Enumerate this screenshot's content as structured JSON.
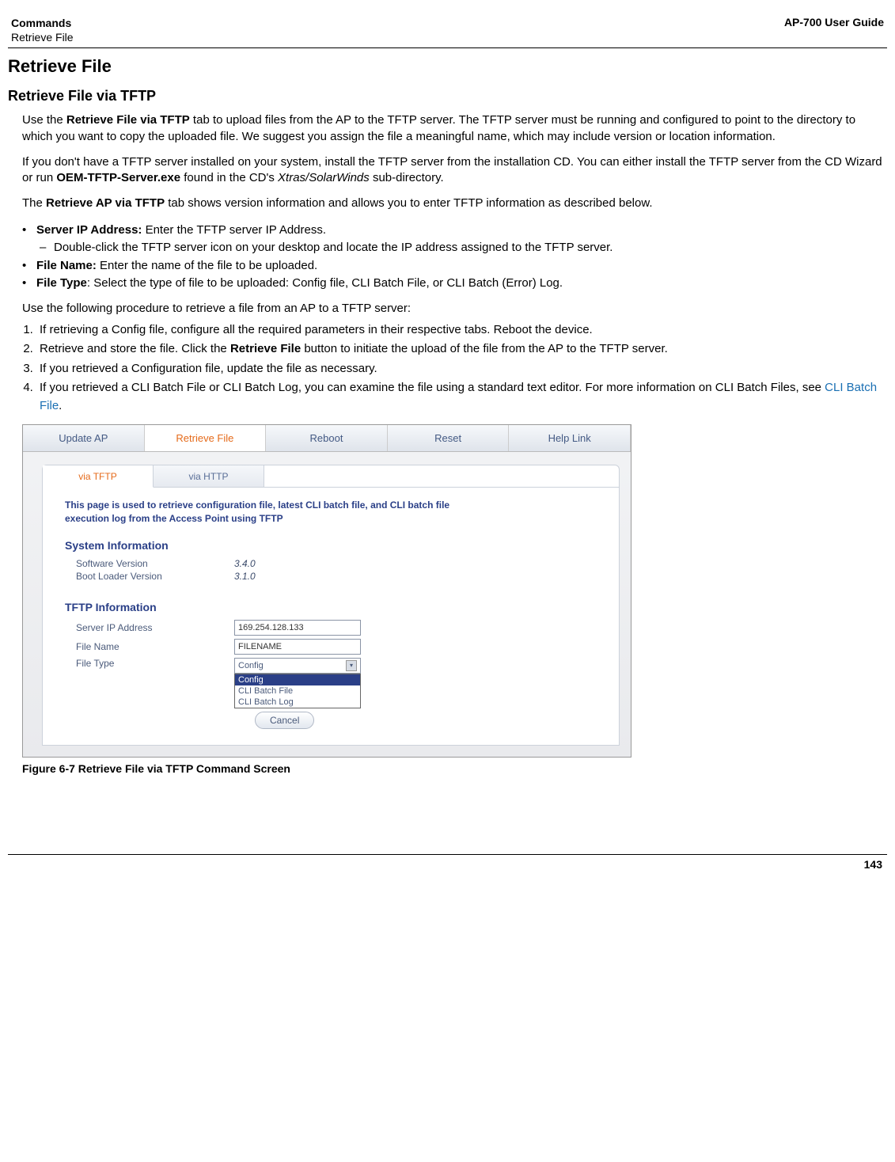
{
  "header": {
    "left_top": "Commands",
    "left_sub": "Retrieve File",
    "right": "AP-700 User Guide"
  },
  "titles": {
    "h1": "Retrieve File",
    "h2": "Retrieve File via TFTP"
  },
  "para1_a": "Use the ",
  "para1_b": "Retrieve File via TFTP",
  "para1_c": " tab to upload files from the AP to the TFTP server. The TFTP server must be running and configured to point to the directory to which you want to copy the uploaded file. We suggest you assign the file a meaningful name, which may include version or location information.",
  "para2_a": "If you don't have a TFTP server installed on your system, install the TFTP server from the installation CD. You can either install the TFTP server from the CD Wizard or run ",
  "para2_b": "OEM-TFTP-Server.exe",
  "para2_c": " found in the CD's ",
  "para2_d": "Xtras/SolarWinds",
  "para2_e": " sub-directory.",
  "para3_a": "The ",
  "para3_b": "Retrieve AP via TFTP",
  "para3_c": " tab shows version information and allows you to enter TFTP information as described below.",
  "bullets": {
    "b1_label": "Server IP Address:",
    "b1_text": " Enter the TFTP server IP Address.",
    "b1_sub": "Double-click the TFTP server icon on your desktop and locate the IP address assigned to the TFTP server.",
    "b2_label": "File Name:",
    "b2_text": " Enter the name of the file to be uploaded.",
    "b3_label": "File Type",
    "b3_text": ": Select the type of file to be uploaded: Config file, CLI Batch File, or CLI Batch (Error) Log."
  },
  "para4": "Use the following procedure to retrieve a file from an AP to a TFTP server:",
  "steps": {
    "s1": "If retrieving a Config file, configure all the required parameters in their respective tabs. Reboot the device.",
    "s2_a": "Retrieve and store the file. Click the ",
    "s2_b": "Retrieve File",
    "s2_c": " button to initiate the upload of the file from the AP to the TFTP server.",
    "s3": "If you retrieved a Configuration file, update the file as necessary.",
    "s4_a": "If you retrieved a CLI Batch File or CLI Batch Log, you can examine the file using a standard text editor. For more information on CLI Batch Files, see ",
    "s4_link": "CLI Batch File",
    "s4_b": "."
  },
  "screenshot": {
    "tabs": [
      "Update AP",
      "Retrieve File",
      "Reboot",
      "Reset",
      "Help Link"
    ],
    "subtabs": [
      "via TFTP",
      "via HTTP"
    ],
    "desc": "This page is used to retrieve configuration file, latest CLI batch file, and CLI batch file execution log from the Access Point using TFTP",
    "sec1": "System Information",
    "sw_label": "Software Version",
    "sw_val": "3.4.0",
    "bl_label": "Boot Loader Version",
    "bl_val": "3.1.0",
    "sec2": "TFTP Information",
    "ip_label": "Server IP Address",
    "ip_val": "169.254.128.133",
    "fn_label": "File Name",
    "fn_val": "FILENAME",
    "ft_label": "File Type",
    "ft_val": "Config",
    "options": [
      "Config",
      "CLI Batch File",
      "CLI Batch Log"
    ],
    "cancel": "Cancel"
  },
  "figure_caption": "Figure 6-7 Retrieve File via TFTP Command Screen",
  "page_number": "143"
}
